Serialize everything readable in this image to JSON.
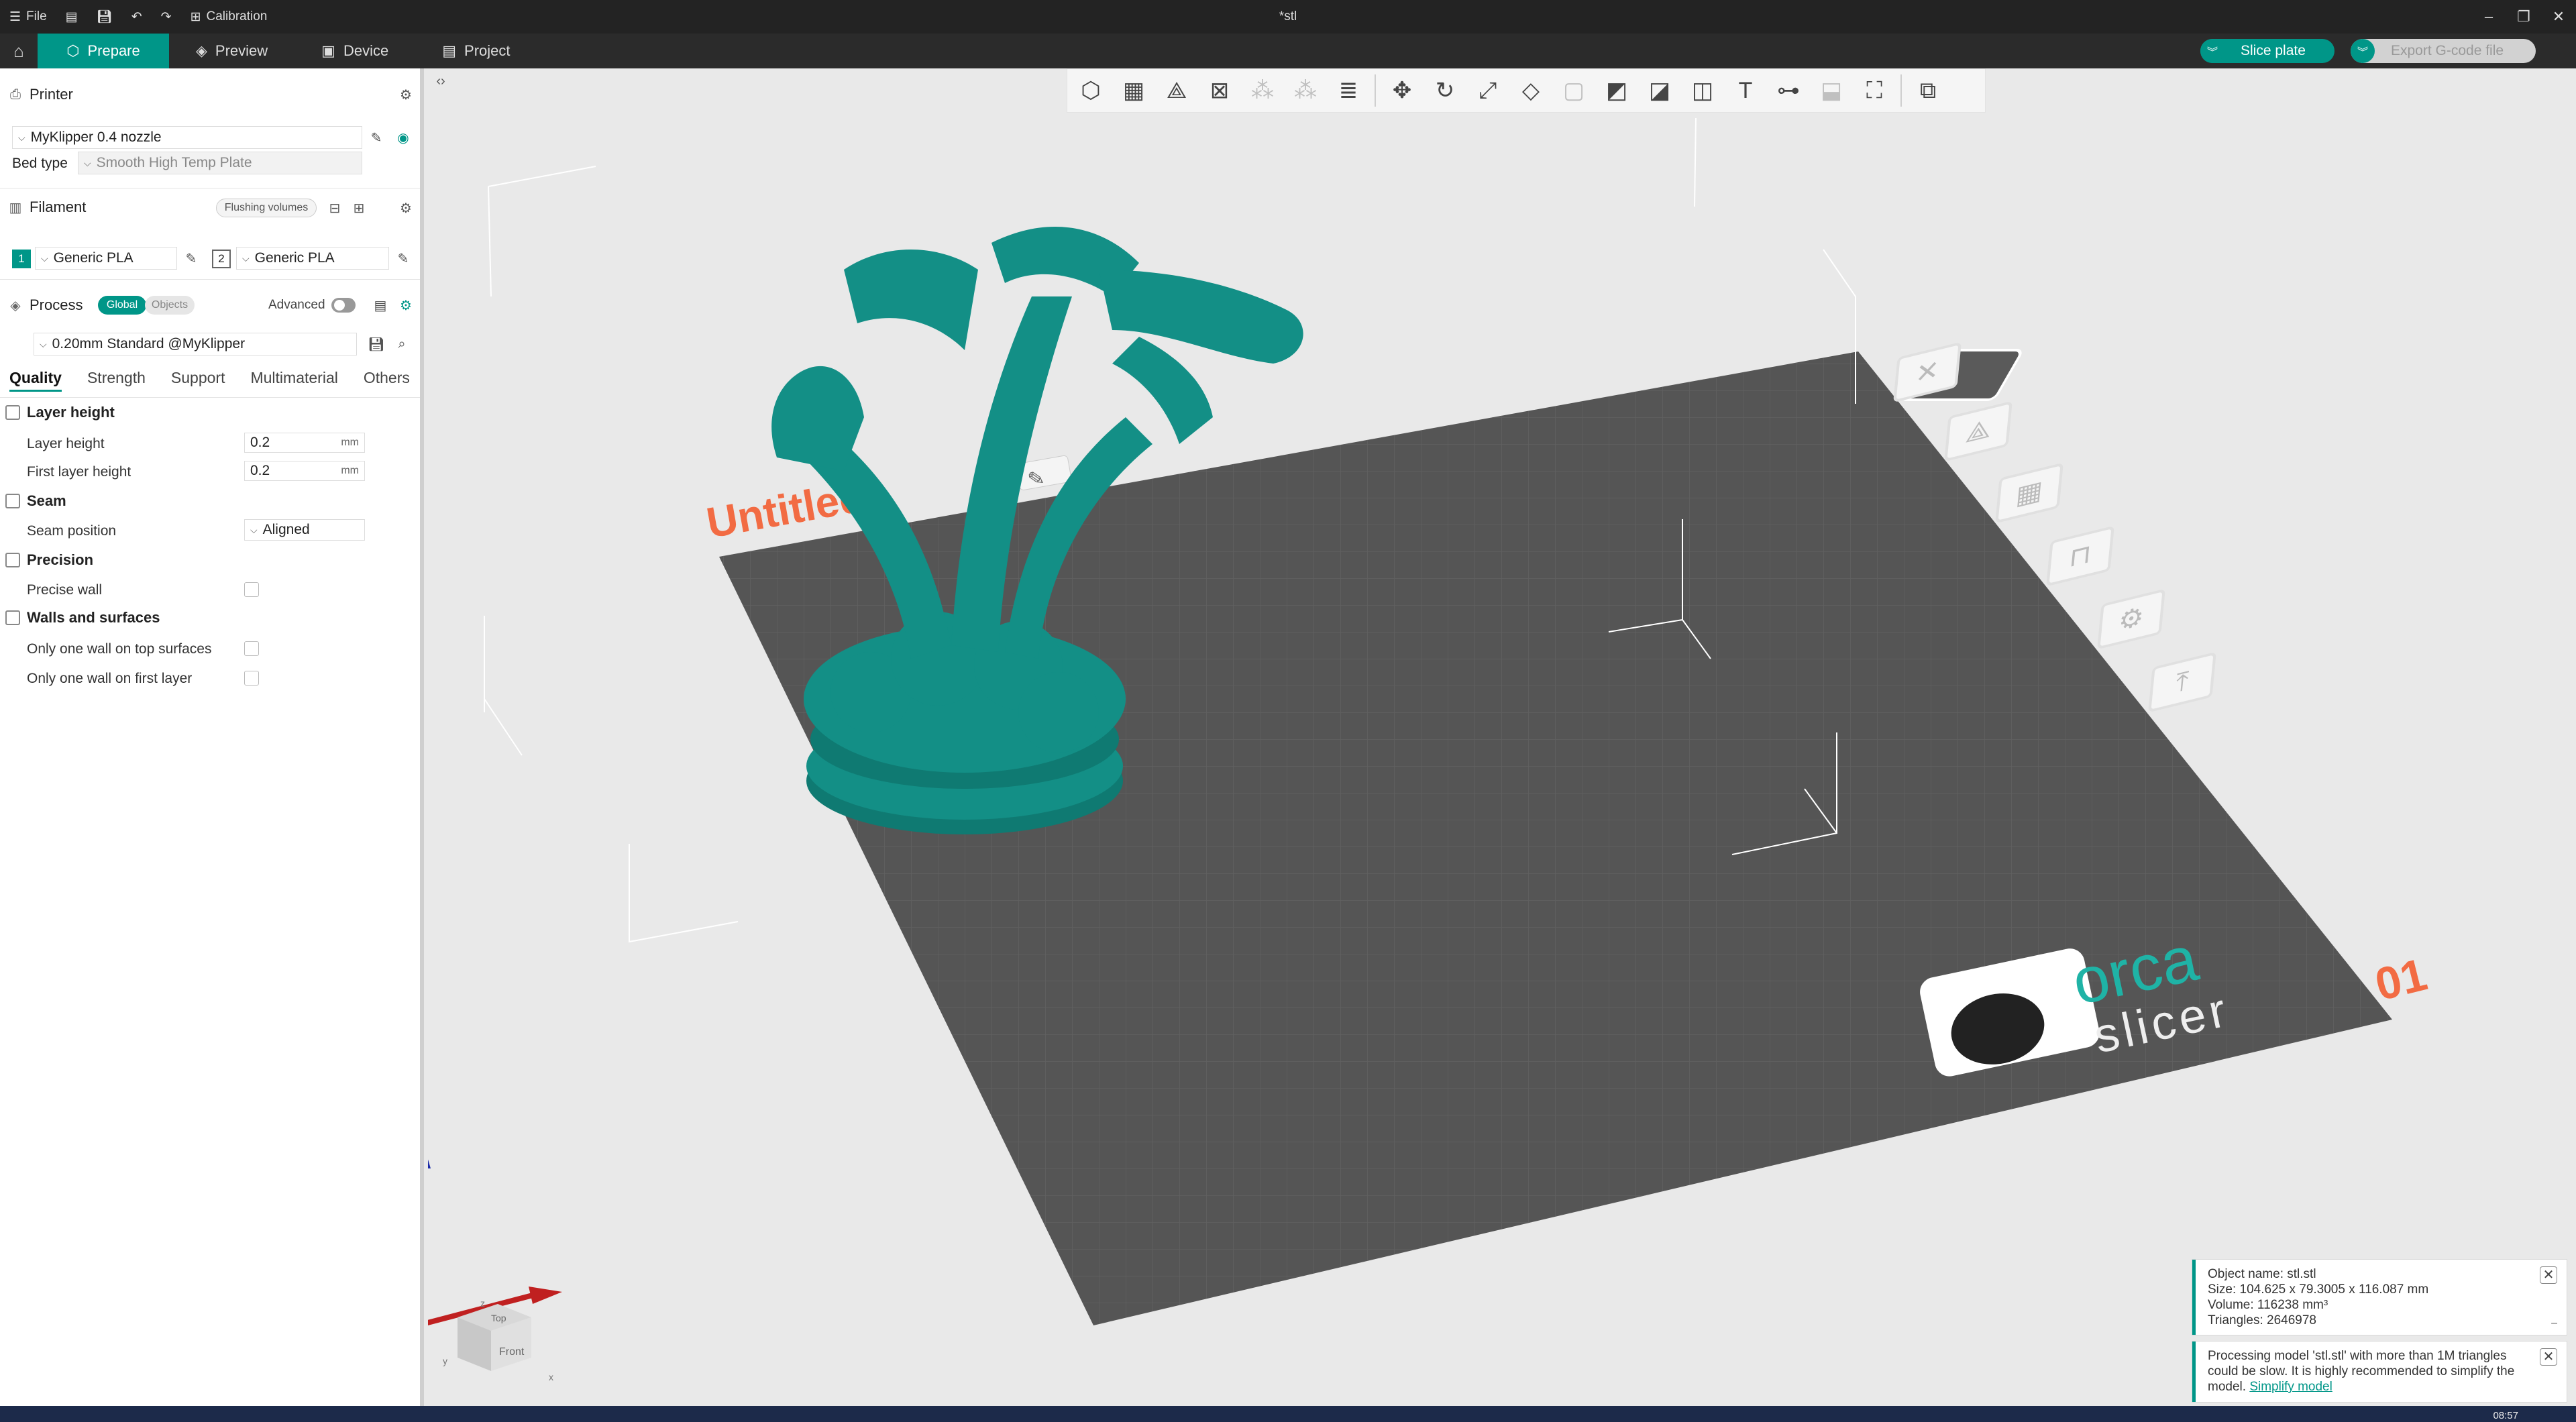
{
  "titlebar": {
    "file_label": "File",
    "calibration_label": "Calibration",
    "window_title": "*stl"
  },
  "tabs": {
    "prepare": "Prepare",
    "preview": "Preview",
    "device": "Device",
    "project": "Project"
  },
  "actions": {
    "slice_plate": "Slice plate",
    "export_gcode": "Export G-code file"
  },
  "printer": {
    "section_label": "Printer",
    "printer_name": "MyKlipper 0.4 nozzle",
    "bed_type_label": "Bed type",
    "bed_type_value": "Smooth High Temp Plate"
  },
  "filament": {
    "section_label": "Filament",
    "flushing_volumes": "Flushing volumes",
    "slots": [
      {
        "index": "1",
        "name": "Generic PLA"
      },
      {
        "index": "2",
        "name": "Generic PLA"
      }
    ]
  },
  "process": {
    "section_label": "Process",
    "global_label": "Global",
    "objects_label": "Objects",
    "advanced_label": "Advanced",
    "preset": "0.20mm Standard @MyKlipper",
    "tabs": [
      "Quality",
      "Strength",
      "Support",
      "Multimaterial",
      "Others"
    ]
  },
  "quality": {
    "layer_height_group": "Layer height",
    "layer_height_label": "Layer height",
    "layer_height_value": "0.2",
    "first_layer_height_label": "First layer height",
    "first_layer_height_value": "0.2",
    "unit": "mm",
    "seam_group": "Seam",
    "seam_position_label": "Seam position",
    "seam_position_value": "Aligned",
    "precision_group": "Precision",
    "precise_wall_label": "Precise wall",
    "walls_group": "Walls and surfaces",
    "one_wall_top_label": "Only one wall on top surfaces",
    "one_wall_first_label": "Only one wall on first layer"
  },
  "plate": {
    "name": "Untitled",
    "number": "01",
    "logo_text_1": "orca",
    "logo_text_2": "slicer"
  },
  "view_cube": {
    "top": "Top",
    "front": "Front"
  },
  "notifications": {
    "object_info": [
      "Object name: stl.stl",
      "Size: 104.625 x 79.3005 x 116.087 mm",
      "Volume: 116238 mm³",
      "Triangles: 2646978"
    ],
    "processing_text": "Processing model 'stl.stl' with more than 1M triangles could be slow. It is highly recommended to simplify the model.",
    "simplify_link": "Simplify model"
  },
  "taskbar": {
    "clock": "08:57"
  },
  "colors": {
    "accent": "#009688",
    "model": "#138f86",
    "plate": "#555555",
    "plate_label": "#f26b43"
  }
}
